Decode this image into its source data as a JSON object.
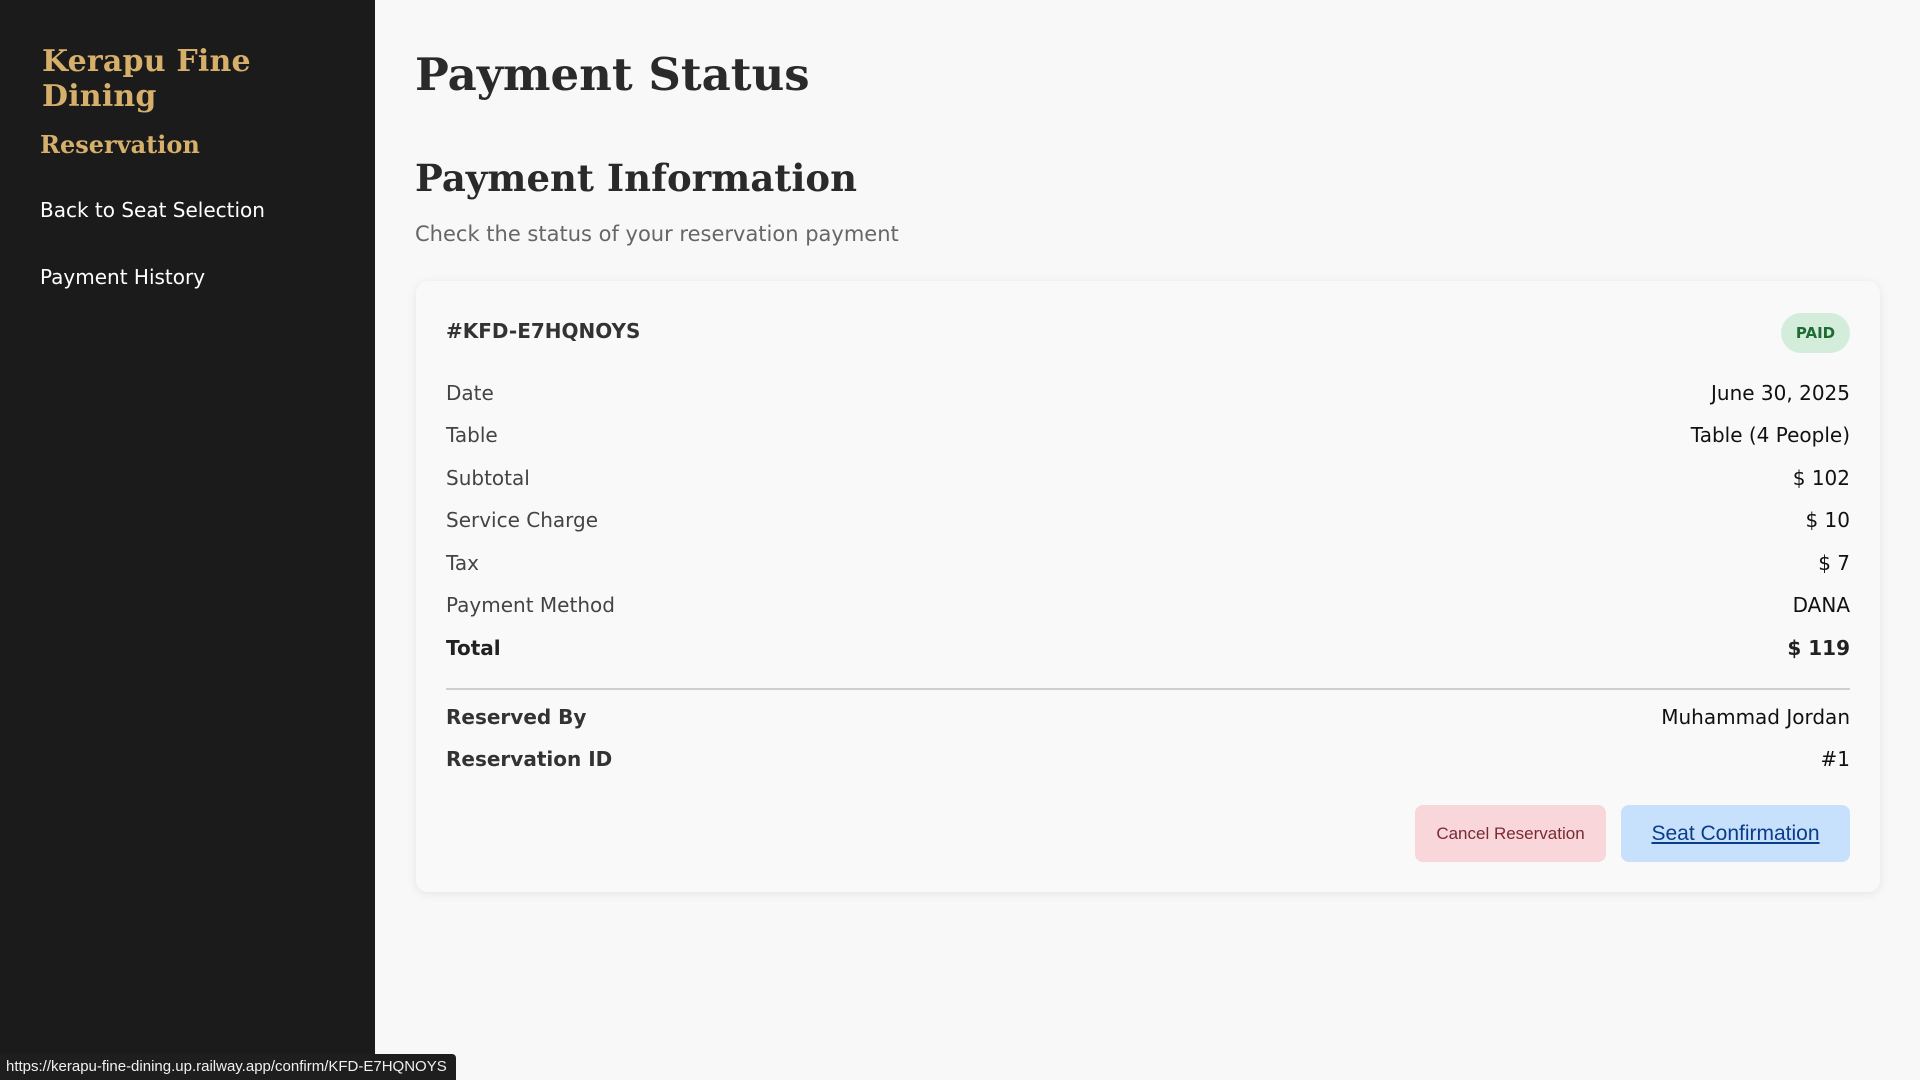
{
  "sidebar": {
    "brand": "Kerapu Fine Dining",
    "section_heading": "Reservation",
    "links": {
      "back": "Back to Seat Selection",
      "history": "Payment History"
    }
  },
  "main": {
    "title": "Payment Status",
    "section_title": "Payment Information",
    "section_subtitle": "Check the status of your reservation payment"
  },
  "card": {
    "order_id": "#KFD-E7HQNOYS",
    "status": "PAID",
    "rows": [
      {
        "label": "Date",
        "value": "June 30, 2025"
      },
      {
        "label": "Table",
        "value": "Table (4 People)"
      },
      {
        "label": "Subtotal",
        "value": "$ 102"
      },
      {
        "label": "Service Charge",
        "value": "$ 10"
      },
      {
        "label": "Tax",
        "value": "$ 7"
      },
      {
        "label": "Payment Method",
        "value": "DANA"
      },
      {
        "label": "Total",
        "value": "$ 119"
      }
    ],
    "reserved_by_label": "Reserved By",
    "reserved_by": "Muhammad Jordan",
    "reservation_id_label": "Reservation ID",
    "reservation_id": "#1",
    "buttons": {
      "cancel": "Cancel Reservation",
      "confirm": "Seat Confirmation"
    }
  },
  "statusbar": {
    "url": "https://kerapu-fine-dining.up.railway.app/confirm/KFD-E7HQNOYS"
  },
  "colors": {
    "sidebar_bg": "#1b1b1b",
    "brand_gold": "#d6b06a",
    "paid_badge_bg": "#d4edda",
    "cancel_bg": "#f8d6da",
    "confirm_bg": "#c7e0fb"
  }
}
